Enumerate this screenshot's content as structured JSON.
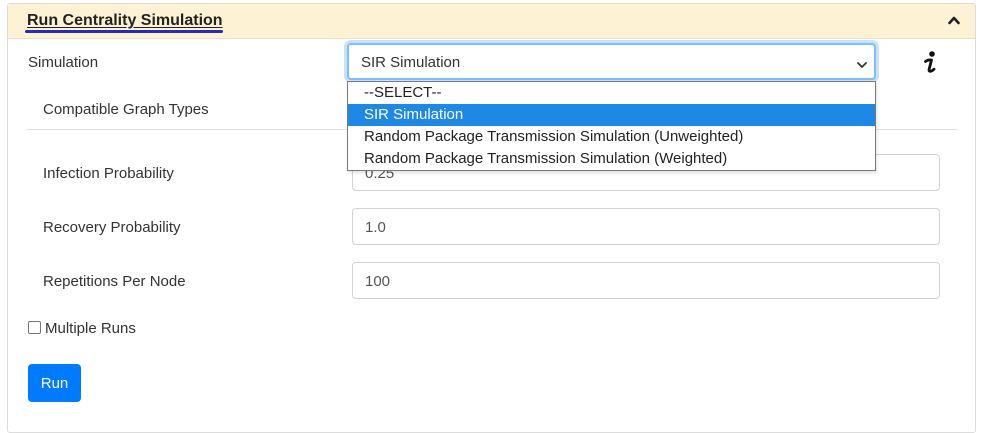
{
  "panel": {
    "title": "Run Centrality Simulation",
    "colors": {
      "header_bg": "#fdf2d3",
      "title_underline": "#2a2ab8",
      "accent": "#007bff"
    }
  },
  "simulation": {
    "label": "Simulation",
    "selected": "SIR Simulation",
    "options": [
      {
        "label": "--SELECT--",
        "selected": false
      },
      {
        "label": "SIR Simulation",
        "selected": true
      },
      {
        "label": "Random Package Transmission Simulation (Unweighted)",
        "selected": false
      },
      {
        "label": "Random Package Transmission Simulation (Weighted)",
        "selected": false
      }
    ]
  },
  "compatible_graph_types": {
    "label": "Compatible Graph Types"
  },
  "parameters": [
    {
      "label": "Infection Probability",
      "value": "0.25"
    },
    {
      "label": "Recovery Probability",
      "value": "1.0"
    },
    {
      "label": "Repetitions Per Node",
      "value": "100"
    }
  ],
  "multiple_runs": {
    "label": "Multiple Runs",
    "checked": false
  },
  "run_button": {
    "label": "Run"
  },
  "icons": {
    "collapse": "chevron-up-icon",
    "info": "info-icon"
  }
}
